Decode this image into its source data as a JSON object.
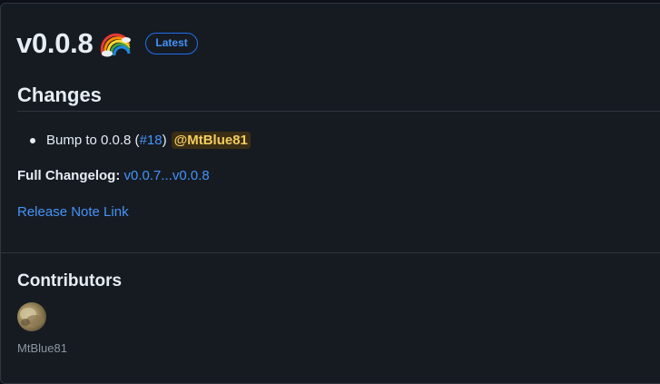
{
  "release": {
    "version": "v0.0.8",
    "emoji_icon": "rainbow-icon",
    "badge": "Latest"
  },
  "changes": {
    "heading": "Changes",
    "items": [
      {
        "text_before": "Bump to 0.0.8 (",
        "pr_link": "#18",
        "text_after": ")",
        "mention": "@MtBlue81"
      }
    ]
  },
  "changelog": {
    "label": "Full Changelog:",
    "link": "v0.0.7...v0.0.8"
  },
  "release_note_link": "Release Note Link",
  "contributors": {
    "heading": "Contributors",
    "users": [
      {
        "name": "MtBlue81"
      }
    ]
  },
  "colors": {
    "background": "#0d1117",
    "card": "#161b22",
    "border": "#30363d",
    "link": "#4493f8",
    "mention_bg": "#3b2e14",
    "mention_text": "#f2cc60"
  }
}
